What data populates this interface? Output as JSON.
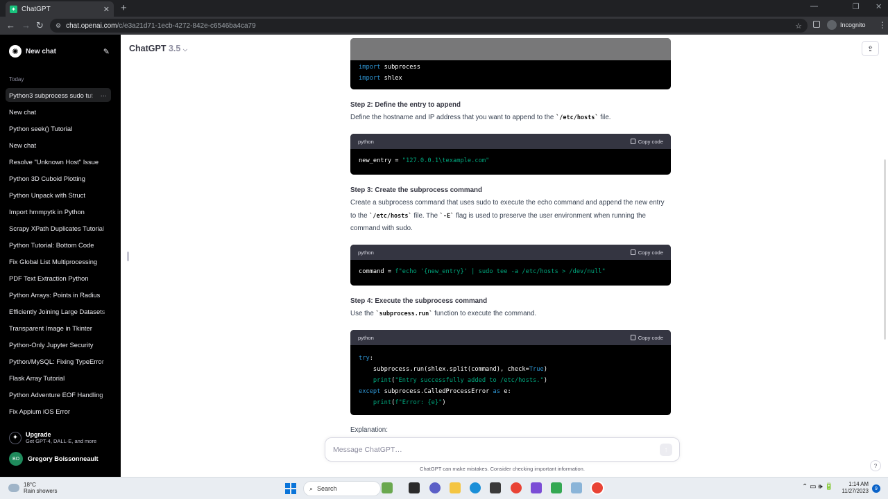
{
  "browser": {
    "tab_title": "ChatGPT",
    "url_host": "chat.openai.com",
    "url_path": "/c/e3a21d71-1ecb-4272-842e-c6546ba4ca79",
    "incognito_label": "Incognito"
  },
  "sidebar": {
    "new_chat_label": "New chat",
    "section_today": "Today",
    "items": [
      {
        "label": "Python3 subprocess sudo tut"
      },
      {
        "label": "New chat"
      },
      {
        "label": "Python seek() Tutorial"
      },
      {
        "label": "New chat"
      },
      {
        "label": "Resolve \"Unknown Host\" Issue"
      },
      {
        "label": "Python 3D Cuboid Plotting"
      },
      {
        "label": "Python Unpack with Struct"
      },
      {
        "label": "Import hmmpytk in Python"
      },
      {
        "label": "Scrapy XPath Duplicates Tutorial"
      },
      {
        "label": "Python Tutorial: Bottom Code"
      },
      {
        "label": "Fix Global List Multiprocessing"
      },
      {
        "label": "PDF Text Extraction Python"
      },
      {
        "label": "Python Arrays: Points in Radius"
      },
      {
        "label": "Efficiently Joining Large Datasets"
      },
      {
        "label": "Transparent Image in Tkinter"
      },
      {
        "label": "Python-Only Jupyter Security"
      },
      {
        "label": "Python/MySQL: Fixing TypeError"
      },
      {
        "label": "Flask Array Tutorial"
      },
      {
        "label": "Python Adventure EOF Handling"
      },
      {
        "label": "Fix Appium iOS Error"
      }
    ],
    "more_glyph": "···",
    "upgrade_title": "Upgrade",
    "upgrade_subtitle": "Get GPT-4, DALL·E, and more",
    "user_initials": "BO",
    "user_name": "Gregory Boissonneault"
  },
  "header": {
    "model_name": "ChatGPT",
    "model_version": "3.5"
  },
  "content": {
    "code_lang": "python",
    "copy_label": "Copy code",
    "code1_line1_kw": "import",
    "code1_line1_rest": " subprocess",
    "code1_line2_kw": "import",
    "code1_line2_rest": " shlex",
    "step2_title": "Step 2: Define the entry to append",
    "step2_text_a": "Define the hostname and IP address that you want to append to the ",
    "step2_code": "`/etc/hosts`",
    "step2_text_b": " file.",
    "code2_var": "new_entry = ",
    "code2_str": "\"127.0.0.1\\texample.com\"",
    "step3_title": "Step 3: Create the subprocess command",
    "step3_text_a": "Create a subprocess command that uses sudo to execute the echo command and append the new entry to the ",
    "step3_code1": "`/etc/hosts`",
    "step3_text_b": " file. The ",
    "step3_code2": "`-E`",
    "step3_text_c": " flag is used to preserve the user environment when running the command with sudo.",
    "code3_var": "command = ",
    "code3_str": "f\"echo '{new_entry}' | sudo tee -a /etc/hosts > /dev/null\"",
    "step4_title": "Step 4: Execute the subprocess command",
    "step4_text_a": "Use the ",
    "step4_code": "`subprocess.run`",
    "step4_text_b": " function to execute the command.",
    "code4_l1_kw": "try",
    "code4_l1_rest": ":",
    "code4_l2_a": "    subprocess.run(shlex.split(command), check=",
    "code4_l2_kw": "True",
    "code4_l2_b": ")",
    "code4_l3_fn": "    print",
    "code4_l3_a": "(",
    "code4_l3_str": "\"Entry successfully added to /etc/hosts.\"",
    "code4_l3_b": ")",
    "code4_l4_kw": "except",
    "code4_l4_a": " subprocess.CalledProcessError ",
    "code4_l4_kw2": "as",
    "code4_l4_b": " e:",
    "code4_l5_fn": "    print",
    "code4_l5_a": "(",
    "code4_l5_str": "f\"Error: {e}\"",
    "code4_l5_b": ")",
    "explanation": "Explanation:"
  },
  "composer": {
    "placeholder": "Message ChatGPT…",
    "disclaimer": "ChatGPT can make mistakes. Consider checking important information.",
    "help": "?"
  },
  "taskbar": {
    "temperature": "18°C",
    "weather": "Rain showers",
    "search_label": "Search",
    "time": "1:14 AM",
    "date": "11/27/2023",
    "notif_count": "9"
  },
  "colors": {
    "sidebar_bg": "#000000",
    "code_bg": "#000000",
    "keyword": "#2e95d3",
    "string": "#00a67d"
  }
}
